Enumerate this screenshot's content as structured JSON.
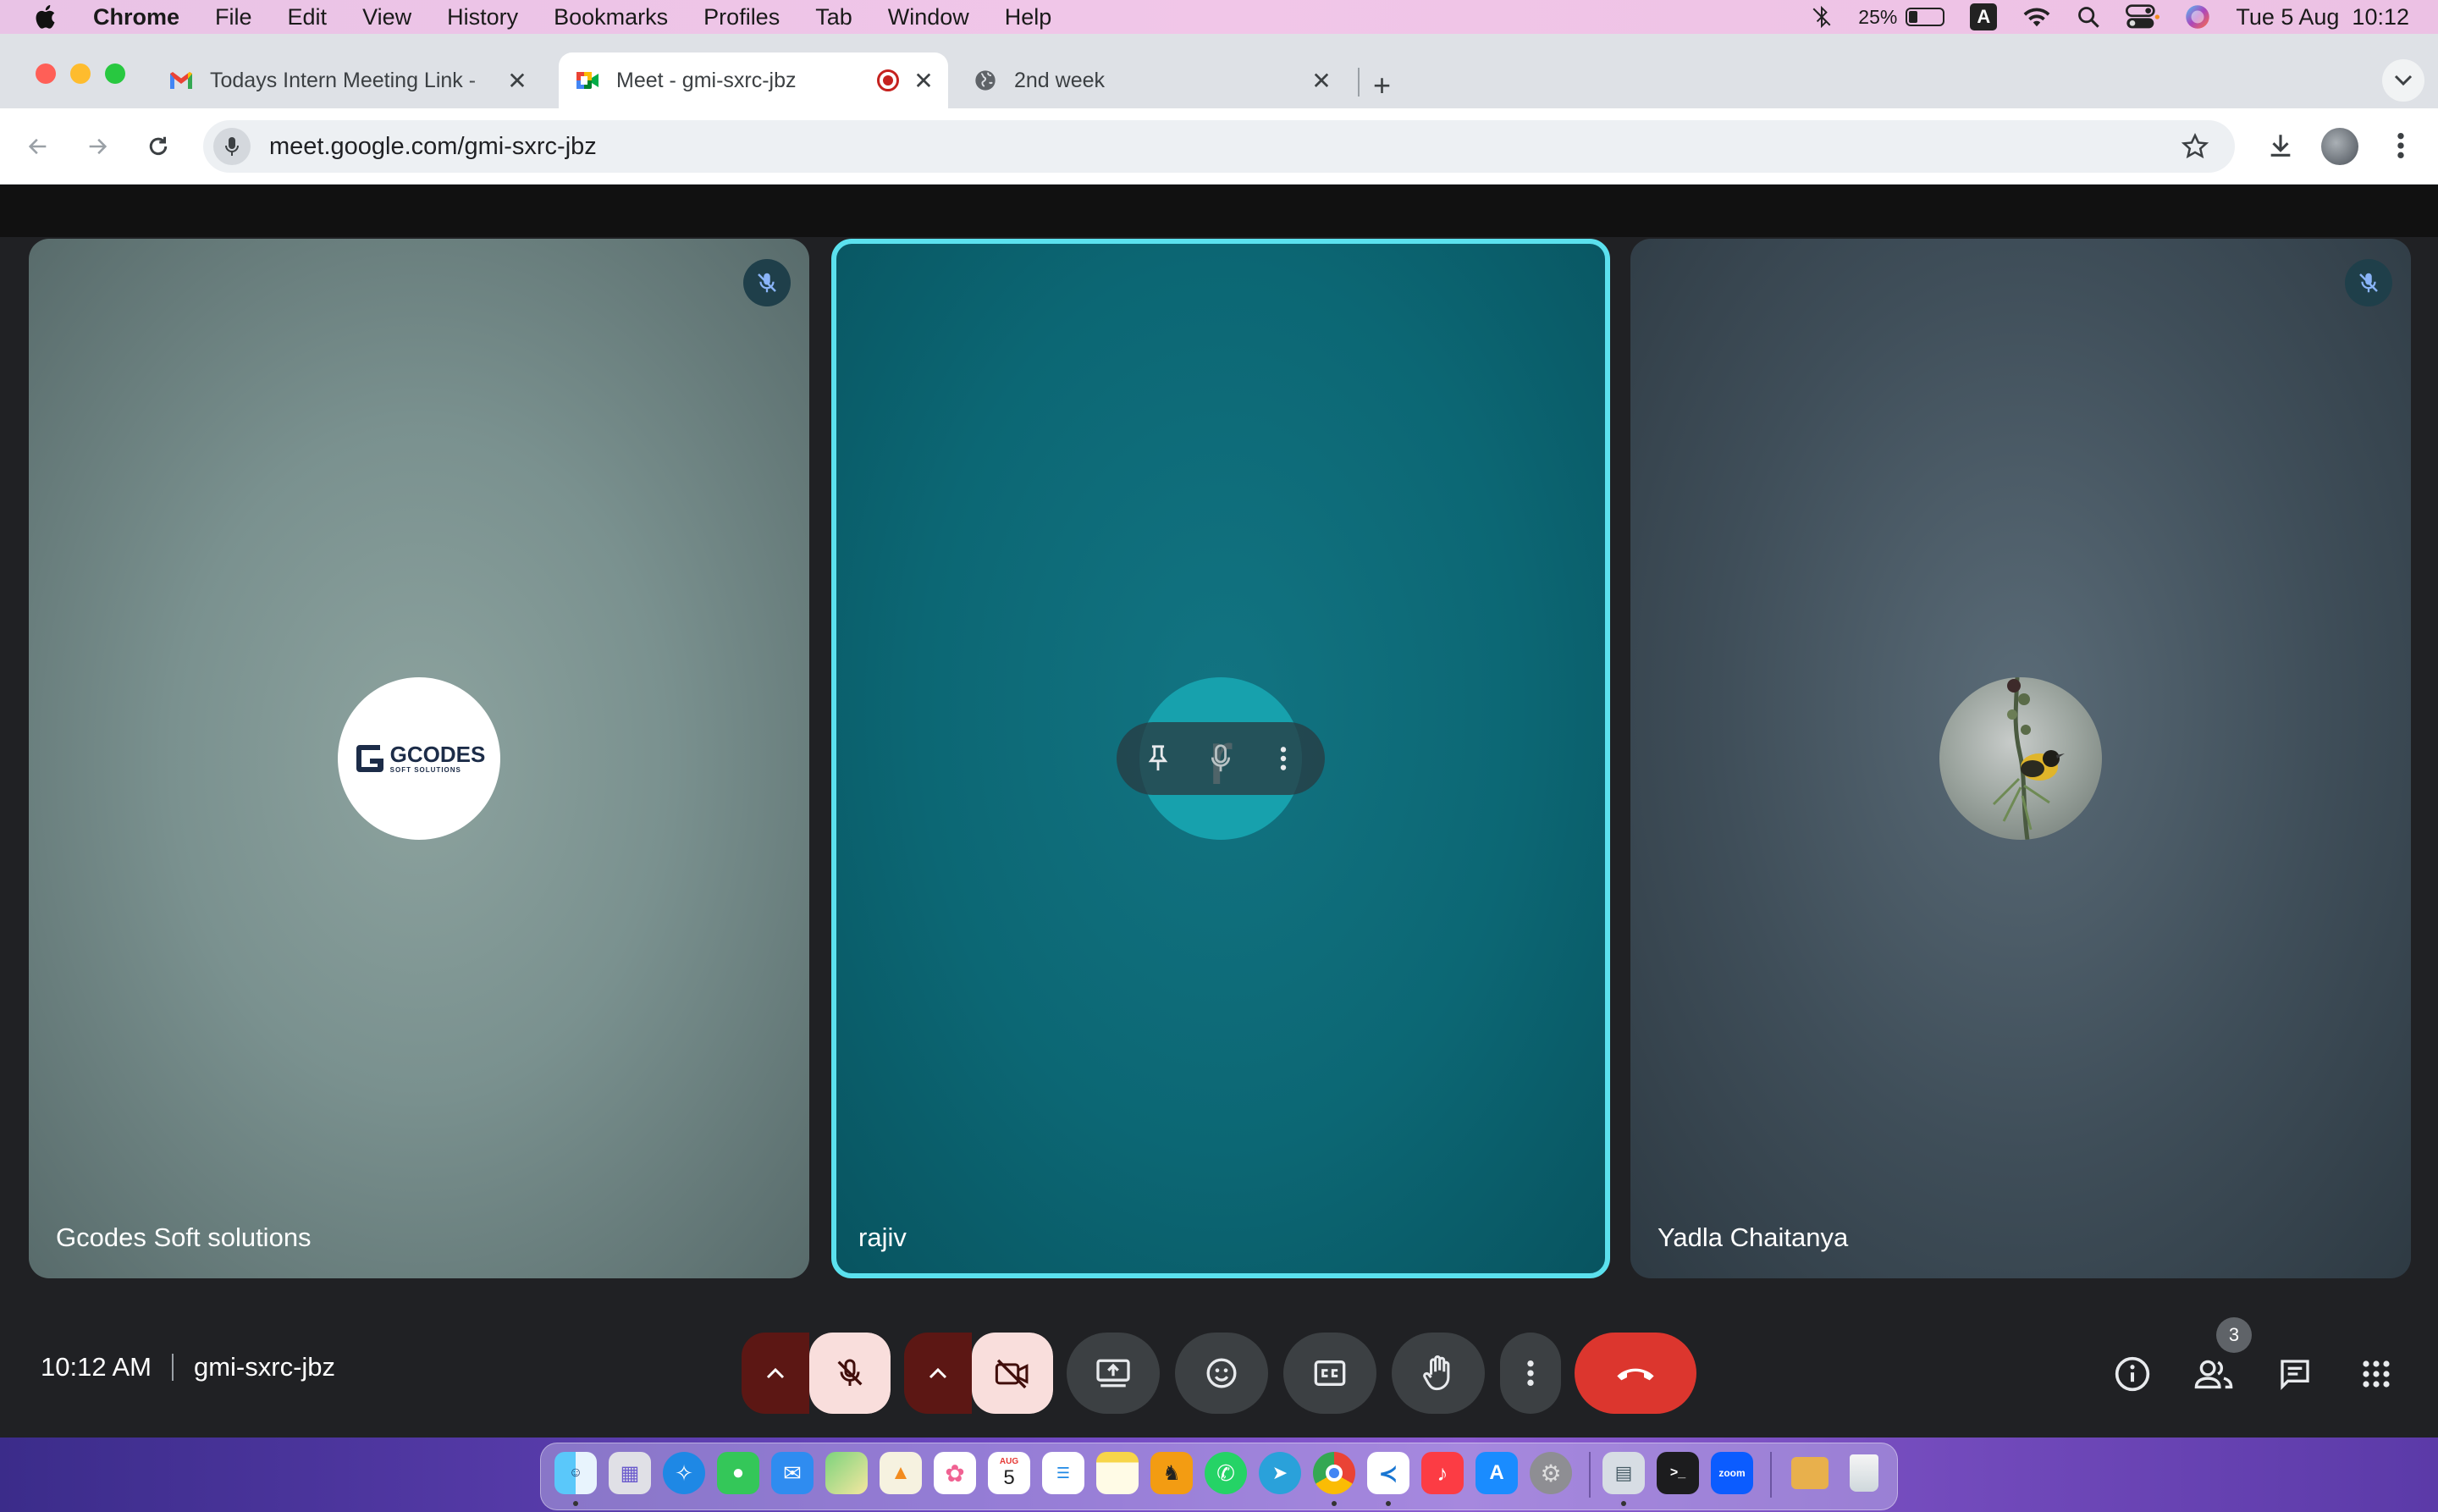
{
  "menubar": {
    "app": "Chrome",
    "items": [
      "File",
      "Edit",
      "View",
      "History",
      "Bookmarks",
      "Profiles",
      "Tab",
      "Window",
      "Help"
    ],
    "battery": "25%",
    "input_source": "A",
    "datetime": "Tue 5 Aug  10:12"
  },
  "tabs": [
    {
      "title": "Todays Intern Meeting Link - ",
      "favicon": "gmail-icon",
      "active": false
    },
    {
      "title": "Meet - gmi-sxrc-jbz",
      "favicon": "meet-icon",
      "active": true,
      "recording": true
    },
    {
      "title": "2nd week",
      "favicon": "globe-icon",
      "active": false
    }
  ],
  "toolbar": {
    "url": "meet.google.com/gmi-sxrc-jbz"
  },
  "participants": [
    {
      "name": "Gcodes Soft solutions",
      "muted": true,
      "logo_big": "GCODES",
      "logo_small": "SOFT SOLUTIONS"
    },
    {
      "name": "rajiv",
      "muted": false,
      "initial": "r",
      "active_speaker": true
    },
    {
      "name": "Yadla Chaitanya",
      "muted": true
    }
  ],
  "meeting": {
    "time": "10:12 AM",
    "code": "gmi-sxrc-jbz",
    "people_count": "3"
  },
  "dock": {
    "zoom_label": "zoom",
    "calendar_month": "AUG",
    "calendar_day": "5"
  },
  "colors": {
    "active_speaker_border": "#5be1ee",
    "end_call": "#dc362e",
    "muted_control_bg": "#f9dedc"
  }
}
